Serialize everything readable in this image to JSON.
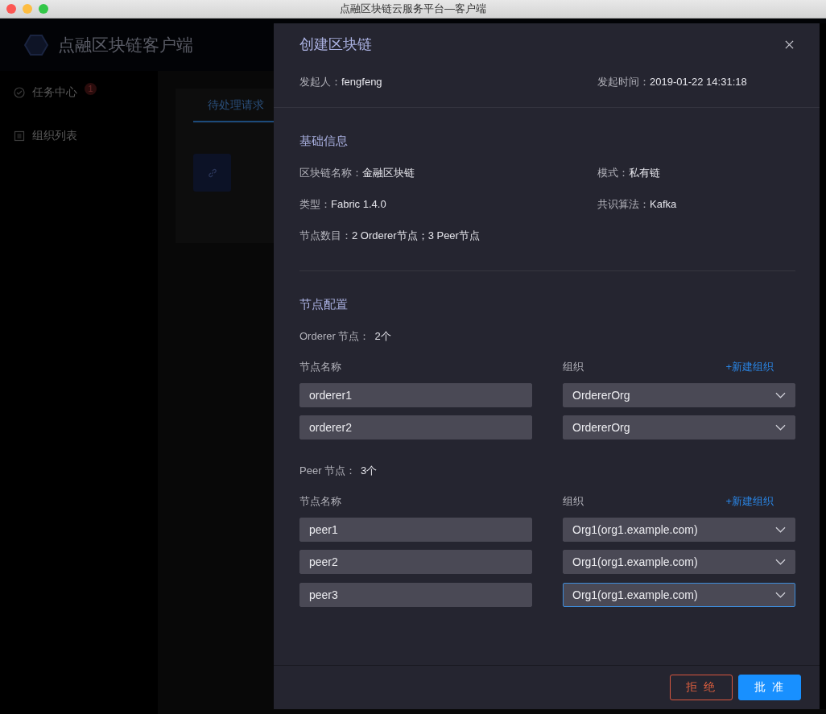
{
  "window": {
    "title": "点融区块链云服务平台—客户端"
  },
  "app": {
    "brand": "点融区块链客户端",
    "sidebar": [
      {
        "label": "任务中心",
        "badge": "1",
        "kind": "task"
      },
      {
        "label": "组织列表",
        "kind": "list"
      }
    ],
    "tabs": [
      {
        "label": "待处理请求",
        "selected": true
      }
    ]
  },
  "drawer": {
    "title": "创建区块链",
    "meta": [
      {
        "label": "发起人：",
        "value": "fengfeng"
      },
      {
        "label": "发起时间：",
        "value": "2019-01-22 14:31:18"
      }
    ],
    "basic": {
      "heading": "基础信息",
      "fields": [
        {
          "label": "区块链名称：",
          "value": "金融区块链"
        },
        {
          "label": "模式：",
          "value": "私有链"
        },
        {
          "label": "类型：",
          "value": "Fabric 1.4.0"
        },
        {
          "label": "共识算法：",
          "value": "Kafka"
        },
        {
          "label": "节点数目：",
          "value": "2 Orderer节点；3 Peer节点"
        }
      ]
    },
    "config": {
      "heading": "节点配置",
      "groups": [
        {
          "label": "Orderer 节点：",
          "count": "2个",
          "name_header": "节点名称",
          "org_header": "组织",
          "new_org": "+新建组织",
          "nodes": [
            {
              "name": "orderer1",
              "org": "OrdererOrg",
              "focused": false
            },
            {
              "name": "orderer2",
              "org": "OrdererOrg",
              "focused": false
            }
          ]
        },
        {
          "label": "Peer 节点：",
          "count": "3个",
          "name_header": "节点名称",
          "org_header": "组织",
          "new_org": "+新建组织",
          "nodes": [
            {
              "name": "peer1",
              "org": "Org1(org1.example.com)",
              "focused": false
            },
            {
              "name": "peer2",
              "org": "Org1(org1.example.com)",
              "focused": false
            },
            {
              "name": "peer3",
              "org": "Org1(org1.example.com)",
              "focused": true
            }
          ]
        }
      ]
    },
    "buttons": [
      {
        "label": "拒 绝",
        "kind": "reject"
      },
      {
        "label": "批 准",
        "kind": "approve"
      }
    ]
  }
}
